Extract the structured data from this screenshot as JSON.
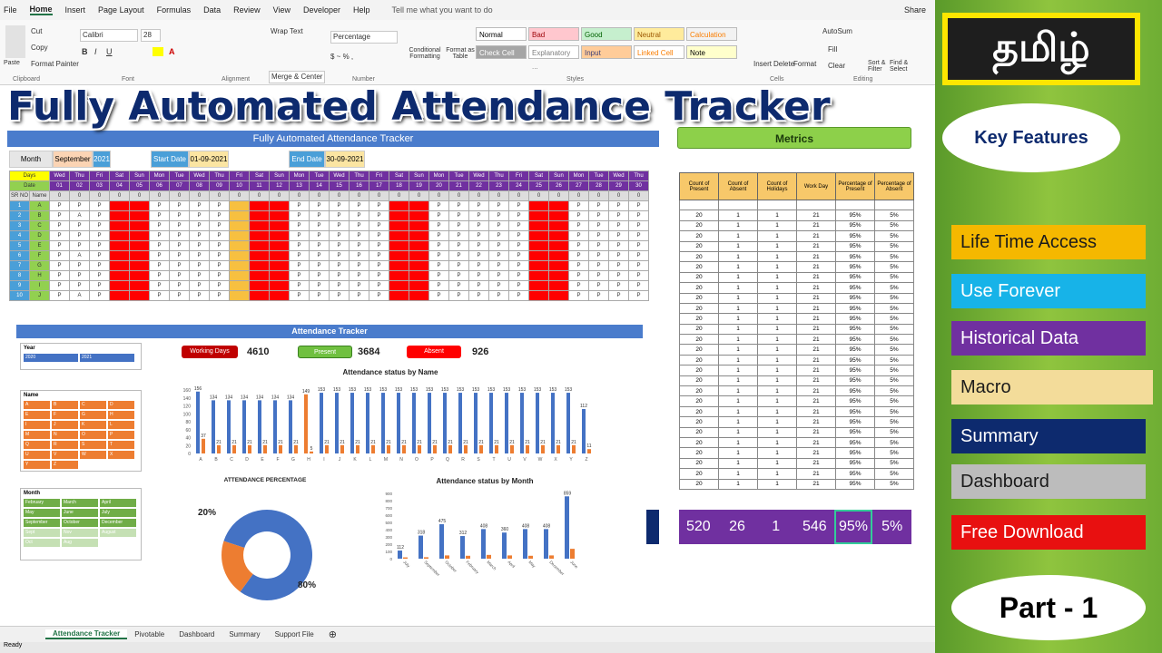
{
  "menu": [
    "File",
    "Home",
    "Insert",
    "Page Layout",
    "Formulas",
    "Data",
    "Review",
    "View",
    "Developer",
    "Help"
  ],
  "tell_me": "Tell me what you want to do",
  "share": "Share",
  "ribbon": {
    "cut": "Cut",
    "copy": "Copy",
    "format_painter": "Format Painter",
    "paste": "Paste",
    "font": "Calibri",
    "size": "28",
    "wrap_text": "Wrap Text",
    "merge_center": "Merge & Center",
    "number_format": "Percentage",
    "cond_format": "Conditional Formatting",
    "format_table": "Format as Table",
    "styles": [
      "Normal",
      "Bad",
      "Good",
      "Neutral",
      "Calculation",
      "Check Cell",
      "Explanatory ...",
      "Input",
      "Linked Cell",
      "Note"
    ],
    "insert": "Insert",
    "delete": "Delete",
    "format": "Format",
    "autosum": "AutoSum",
    "fill": "Fill",
    "clear": "Clear",
    "sort": "Sort & Filter",
    "find": "Find & Select",
    "groups": [
      "Clipboard",
      "Font",
      "Alignment",
      "Number",
      "Styles",
      "Cells",
      "Editing"
    ]
  },
  "overlay_title": "Fully Automated Attendance Tracker",
  "sheet": {
    "title": "Fully Automated Attendance Tracker",
    "month_label": "Month",
    "month": "September",
    "year": "2021",
    "start_label": "Start Date",
    "start": "01-09-2021",
    "end_label": "End Date",
    "end": "30-09-2021",
    "days_label": "Days",
    "date_label": "Date",
    "srno": "SR NO",
    "name": "Name",
    "days": [
      "Wed",
      "Thu",
      "Fri",
      "Sat",
      "Sun",
      "Mon",
      "Tue",
      "Wed",
      "Thu",
      "Fri",
      "Sat",
      "Sun",
      "Mon",
      "Tue",
      "Wed",
      "Thu",
      "Fri",
      "Sat",
      "Sun",
      "Mon",
      "Tue",
      "Wed",
      "Thu",
      "Fri",
      "Sat",
      "Sun",
      "Mon",
      "Tue",
      "Wed",
      "Thu"
    ],
    "names": [
      "A",
      "B",
      "C",
      "D",
      "E",
      "F",
      "G",
      "H",
      "I",
      "J"
    ]
  },
  "dashboard": {
    "banner": "Attendance Tracker",
    "working_days_label": "Working Days",
    "working_days": "4610",
    "present_label": "Present",
    "present": "3684",
    "absent_label": "Absent",
    "absent": "926",
    "year_slicer": "Year",
    "years": [
      "2020",
      "2021"
    ],
    "name_slicer": "Name",
    "month_slicer": "Month",
    "months": [
      "February",
      "March",
      "April",
      "May",
      "June",
      "July",
      "September",
      "October",
      "December",
      "Sept",
      "Nov",
      "August",
      "Oct",
      "Aug"
    ],
    "pct_title": "ATTENDANCE PERCENTAGE",
    "pct_present": "80%",
    "pct_absent": "20%",
    "name_chart_title": "Attendance status by Name",
    "month_chart_title": "Attendance status by Month"
  },
  "metrics": {
    "header": "Metrics",
    "columns": [
      "Count of Present",
      "Count of Absent",
      "Count of Holidays",
      "Work Day",
      "Percentage of Present",
      "Percentage of Absent"
    ],
    "row": [
      "20",
      "1",
      "1",
      "21",
      "95%",
      "5%"
    ],
    "totals": [
      "520",
      "26",
      "1",
      "546",
      "95%",
      "5%"
    ]
  },
  "tabs": [
    "Attendance Tracker",
    "Pivotable",
    "Dashboard",
    "Summary",
    "Support File"
  ],
  "status": "Ready",
  "sidebar": {
    "tamil": "தமிழ்",
    "key_features": "Key Features",
    "features": [
      {
        "label": "Life Time Access",
        "bg": "#f5b800",
        "fg": "#1b1b1b"
      },
      {
        "label": "Use Forever",
        "bg": "#17b3e8",
        "fg": "#ffffff"
      },
      {
        "label": "Historical Data",
        "bg": "#7030a0",
        "fg": "#ffffff"
      },
      {
        "label": "Macro",
        "bg": "#f3dc9a",
        "fg": "#1b1b1b"
      },
      {
        "label": "Summary",
        "bg": "#0d2a6e",
        "fg": "#ffffff"
      },
      {
        "label": "Dashboard",
        "bg": "#bcbcbc",
        "fg": "#1b1b1b"
      },
      {
        "label": "Free Download",
        "bg": "#e81010",
        "fg": "#ffffff"
      }
    ],
    "part": "Part - 1"
  },
  "chart_data": [
    {
      "type": "bar",
      "title": "Attendance status by Name",
      "categories": [
        "A",
        "B",
        "C",
        "D",
        "E",
        "F",
        "G",
        "H",
        "I",
        "J",
        "K",
        "L",
        "M",
        "N",
        "O",
        "P",
        "Q",
        "R",
        "S",
        "T",
        "U",
        "V",
        "W",
        "X",
        "Y",
        "Z"
      ],
      "series": [
        {
          "values": [
            156,
            134,
            134,
            134,
            134,
            134,
            134,
            149,
            153,
            153,
            153,
            153,
            153,
            153,
            153,
            153,
            153,
            153,
            153,
            153,
            153,
            153,
            153,
            153,
            153,
            112
          ]
        },
        {
          "values": [
            37,
            21,
            21,
            21,
            21,
            21,
            21,
            5,
            21,
            21,
            21,
            21,
            21,
            21,
            21,
            21,
            21,
            21,
            21,
            21,
            21,
            21,
            21,
            21,
            21,
            11
          ]
        }
      ]
    },
    {
      "type": "pie",
      "title": "ATTENDANCE PERCENTAGE",
      "categories": [
        "Present",
        "Absent"
      ],
      "values": [
        80,
        20
      ]
    },
    {
      "type": "bar",
      "title": "Attendance status by Month",
      "categories": [
        "July",
        "September",
        "October",
        "February",
        "March",
        "April",
        "May",
        "December",
        "June"
      ],
      "series": [
        {
          "values": [
            112,
            318,
            475,
            312,
            408,
            360,
            408,
            408,
            859
          ]
        },
        {
          "values": [
            18,
            20,
            45,
            40,
            52,
            45,
            40,
            45,
            136
          ]
        }
      ],
      "ylim": [
        0,
        900
      ]
    }
  ]
}
